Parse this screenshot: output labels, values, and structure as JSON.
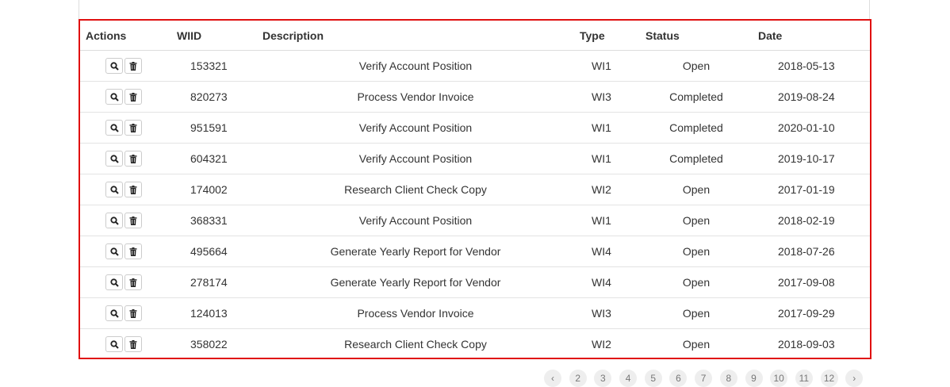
{
  "table": {
    "headers": [
      "Actions",
      "WIID",
      "Description",
      "Type",
      "Status",
      "Date"
    ],
    "rows": [
      {
        "wiid": "153321",
        "description": "Verify Account Position",
        "type": "WI1",
        "status": "Open",
        "date": "2018-05-13"
      },
      {
        "wiid": "820273",
        "description": "Process Vendor Invoice",
        "type": "WI3",
        "status": "Completed",
        "date": "2019-08-24"
      },
      {
        "wiid": "951591",
        "description": "Verify Account Position",
        "type": "WI1",
        "status": "Completed",
        "date": "2020-01-10"
      },
      {
        "wiid": "604321",
        "description": "Verify Account Position",
        "type": "WI1",
        "status": "Completed",
        "date": "2019-10-17"
      },
      {
        "wiid": "174002",
        "description": "Research Client Check Copy",
        "type": "WI2",
        "status": "Open",
        "date": "2017-01-19"
      },
      {
        "wiid": "368331",
        "description": "Verify Account Position",
        "type": "WI1",
        "status": "Open",
        "date": "2018-02-19"
      },
      {
        "wiid": "495664",
        "description": "Generate Yearly Report for Vendor",
        "type": "WI4",
        "status": "Open",
        "date": "2018-07-26"
      },
      {
        "wiid": "278174",
        "description": "Generate Yearly Report for Vendor",
        "type": "WI4",
        "status": "Open",
        "date": "2017-09-08"
      },
      {
        "wiid": "124013",
        "description": "Process Vendor Invoice",
        "type": "WI3",
        "status": "Open",
        "date": "2017-09-29"
      },
      {
        "wiid": "358022",
        "description": "Research Client Check Copy",
        "type": "WI2",
        "status": "Open",
        "date": "2018-09-03"
      }
    ],
    "row_actions": [
      {
        "icon": "search-icon",
        "name": "view-button"
      },
      {
        "icon": "trash-icon",
        "name": "delete-button"
      }
    ]
  },
  "pagination": {
    "items": [
      "‹",
      "2",
      "3",
      "4",
      "5",
      "6",
      "7",
      "8",
      "9",
      "10",
      "11",
      "12",
      "›"
    ]
  },
  "colors": {
    "highlight_border": "#e01010",
    "row_divider": "#e3e3e3",
    "text": "#333333",
    "pager_bg": "#eeeeee"
  }
}
